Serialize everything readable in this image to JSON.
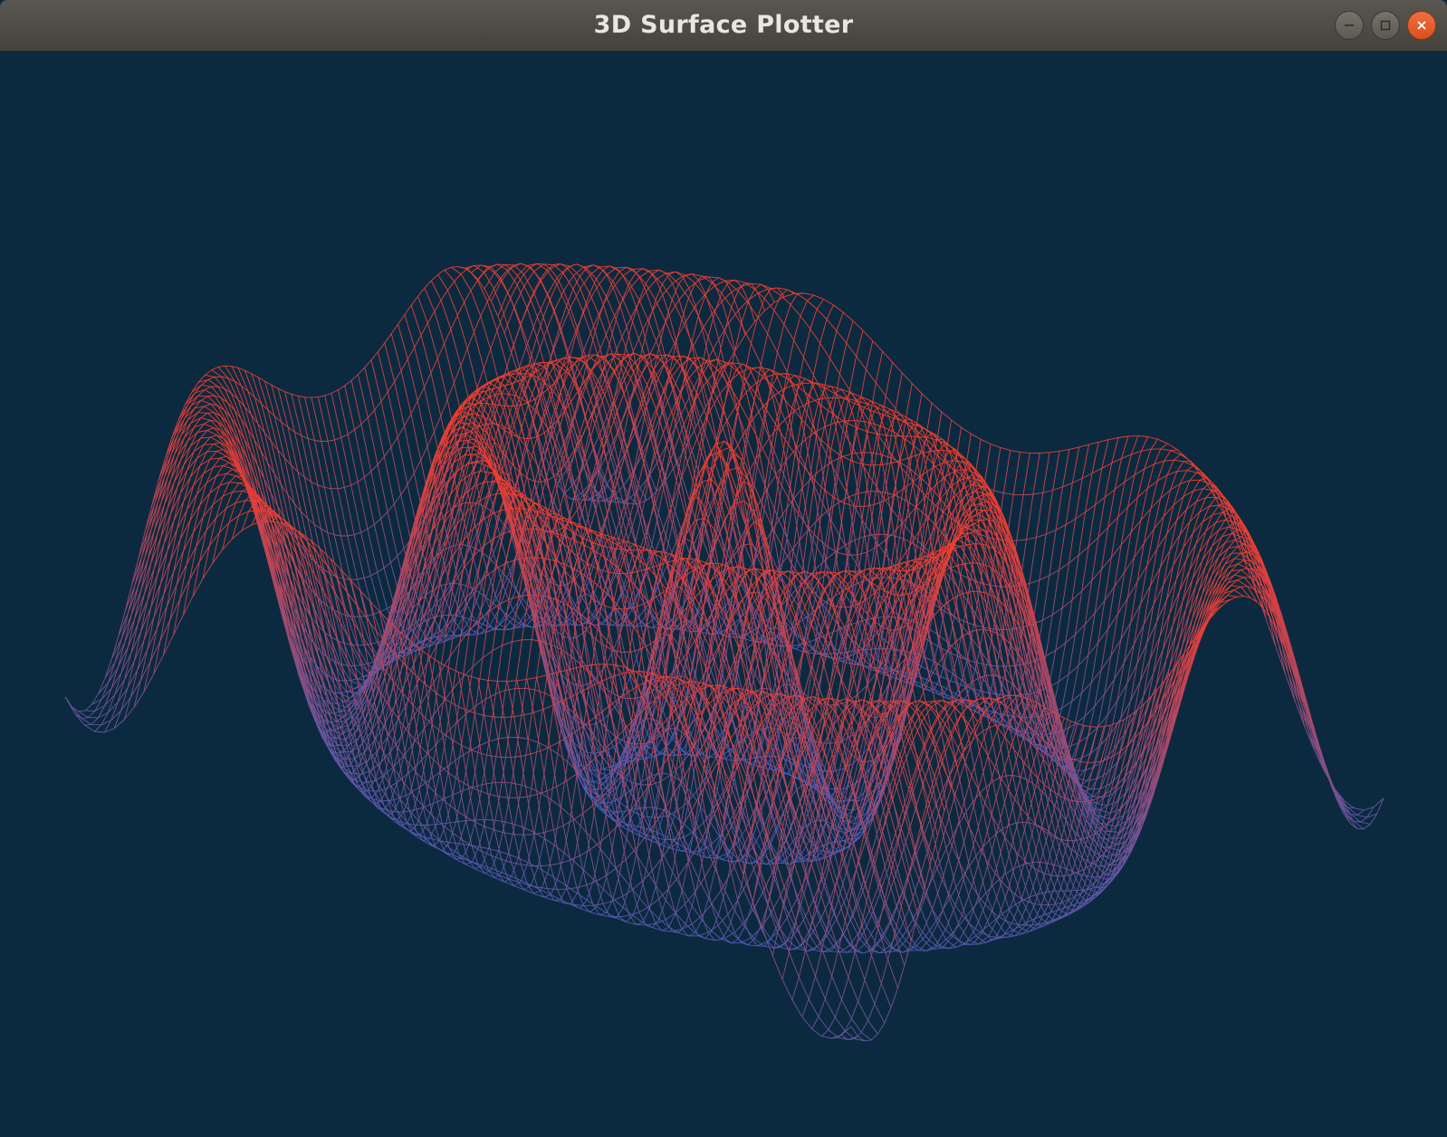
{
  "window": {
    "title": "3D Surface Plotter",
    "controls": {
      "minimize": "minimize-icon",
      "maximize": "maximize-icon",
      "close": "close-icon"
    }
  },
  "colors": {
    "background": "#0c2a3f",
    "surface_high": "#ff3a22",
    "surface_low": "#2f5fcf",
    "close_button": "#e95420"
  },
  "chart_data": {
    "type": "surface-wireframe",
    "function": "ripple",
    "grid": false,
    "axes_visible": false
  }
}
